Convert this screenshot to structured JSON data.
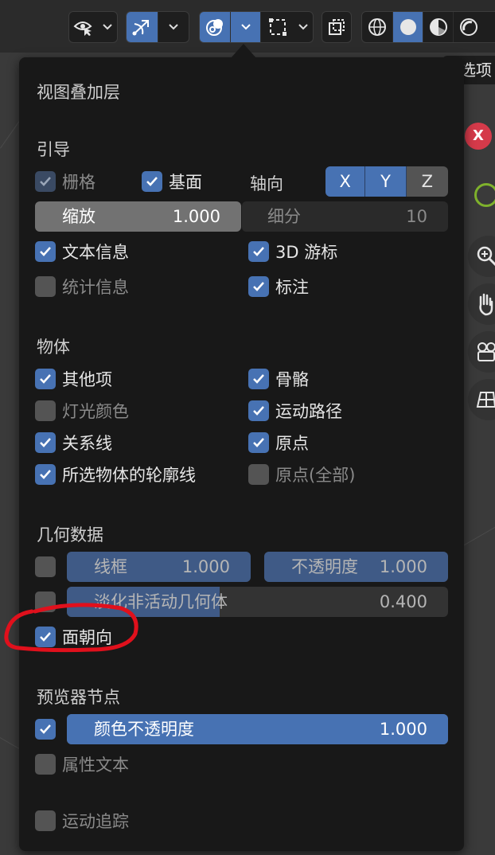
{
  "toolbar": {
    "right_tab_label": "选项"
  },
  "gizmo": {
    "x_label": "X"
  },
  "panel": {
    "title": "视图叠加层",
    "guides": {
      "header": "引导",
      "grid": "栅格",
      "floor": "基面",
      "axes": "轴向",
      "axis_x": "X",
      "axis_y": "Y",
      "axis_z": "Z",
      "scale_label": "缩放",
      "scale_value": "1.000",
      "subdiv_label": "细分",
      "subdiv_value": "10",
      "text_info": "文本信息",
      "cursor_3d": "3D 游标",
      "statistics": "统计信息",
      "annotations": "标注"
    },
    "objects": {
      "header": "物体",
      "extras": "其他项",
      "bones": "骨骼",
      "light_colors": "灯光颜色",
      "motion_paths": "运动路径",
      "relationship_lines": "关系线",
      "origins": "原点",
      "outline_selected": "所选物体的轮廓线",
      "origins_all": "原点(全部)"
    },
    "geometry": {
      "header": "几何数据",
      "wireframe_label": "线框",
      "wireframe_value": "1.000",
      "opacity_label": "不透明度",
      "opacity_value": "1.000",
      "fade_label": "淡化非活动几何体",
      "fade_value": "0.400",
      "face_orientation": "面朝向"
    },
    "viewer": {
      "header": "预览器节点",
      "color_opacity_label": "颜色不透明度",
      "color_opacity_value": "1.000",
      "attribute_text": "属性文本"
    },
    "motion_tracking": "运动追踪"
  },
  "colors": {
    "accent": "#4772b3",
    "panel_bg": "#181818",
    "annotation_circle": "#e0101c"
  }
}
